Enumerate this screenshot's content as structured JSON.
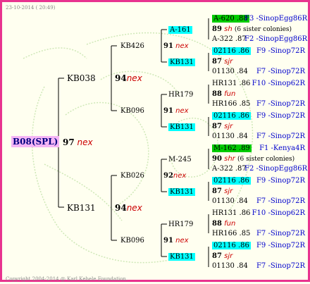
{
  "header": {
    "date": "23-10-2014 ( 20:49)"
  },
  "footer": {
    "copyright": "Copyright 2004-2014 @ Karl Kehele Foundation."
  },
  "root": {
    "id": "B08(SPL)",
    "num": "97",
    "word": "nex"
  },
  "gen1": [
    {
      "id": "KB038",
      "num": "94",
      "word": "nex"
    },
    {
      "id": "KB131",
      "num": "94",
      "word": "nex"
    }
  ],
  "gen2": [
    {
      "id": "KB426",
      "num": "91",
      "word": "nex"
    },
    {
      "id": "KB096",
      "num": "91",
      "word": "nex"
    },
    {
      "id": "KB026",
      "num": "92",
      "word": "nex"
    },
    {
      "id": "KB096",
      "num": "91",
      "word": "nex"
    }
  ],
  "gen3": [
    {
      "id": "A-161",
      "cyan": true
    },
    {
      "id": "KB131",
      "cyan": true
    },
    {
      "id": "HR179",
      "cyan": false
    },
    {
      "id": "KB131",
      "cyan": true
    },
    {
      "id": "M-245",
      "cyan": false
    },
    {
      "id": "KB131",
      "cyan": true
    },
    {
      "id": "HR179",
      "cyan": false
    },
    {
      "id": "KB131",
      "cyan": true
    }
  ],
  "gen4": [
    {
      "top": "A-620 .88",
      "top_color": "green",
      "top_right": "F3 -SinopEgg86R",
      "mid_num": "89",
      "mid_word": "sh",
      "mid_note": "(6 sister colonies)",
      "bot": "A-322 .87",
      "bot_right": "F2 -SinopEgg86R"
    },
    {
      "top": "02116 .86",
      "top_color": "cyan",
      "top_right": "F9 -Sinop72R",
      "mid_num": "87",
      "mid_word": "sjr",
      "mid_note": "",
      "bot": "01130 .84",
      "bot_right": "F7 -Sinop72R"
    },
    {
      "top": "HR131 .86",
      "top_color": "",
      "top_right": "F10 -Sinop62R",
      "mid_num": "88",
      "mid_word": "fun",
      "mid_note": "",
      "bot": "HR166 .85",
      "bot_right": "F7 -Sinop72R"
    },
    {
      "top": "02116 .86",
      "top_color": "cyan",
      "top_right": "F9 -Sinop72R",
      "mid_num": "87",
      "mid_word": "sjr",
      "mid_note": "",
      "bot": "01130 .84",
      "bot_right": "F7 -Sinop72R"
    },
    {
      "top": "M-162 .89",
      "top_color": "green",
      "top_right": "F1 -Kenya4R",
      "mid_num": "90",
      "mid_word": "shr",
      "mid_note": "(6 sister colonies)",
      "bot": "A-322 .87",
      "bot_right": "F2 -SinopEgg86R"
    },
    {
      "top": "02116 .86",
      "top_color": "cyan",
      "top_right": "F9 -Sinop72R",
      "mid_num": "87",
      "mid_word": "sjr",
      "mid_note": "",
      "bot": "01130 .84",
      "bot_right": "F7 -Sinop72R"
    },
    {
      "top": "HR131 .86",
      "top_color": "",
      "top_right": "F10 -Sinop62R",
      "mid_num": "88",
      "mid_word": "fun",
      "mid_note": "",
      "bot": "HR166 .85",
      "bot_right": "F7 -Sinop72R"
    },
    {
      "top": "02116 .86",
      "top_color": "cyan",
      "top_right": "F9 -Sinop72R",
      "mid_num": "87",
      "mid_word": "sjr",
      "mid_note": "",
      "bot": "01130 .84",
      "bot_right": "F7 -Sinop72R"
    }
  ]
}
